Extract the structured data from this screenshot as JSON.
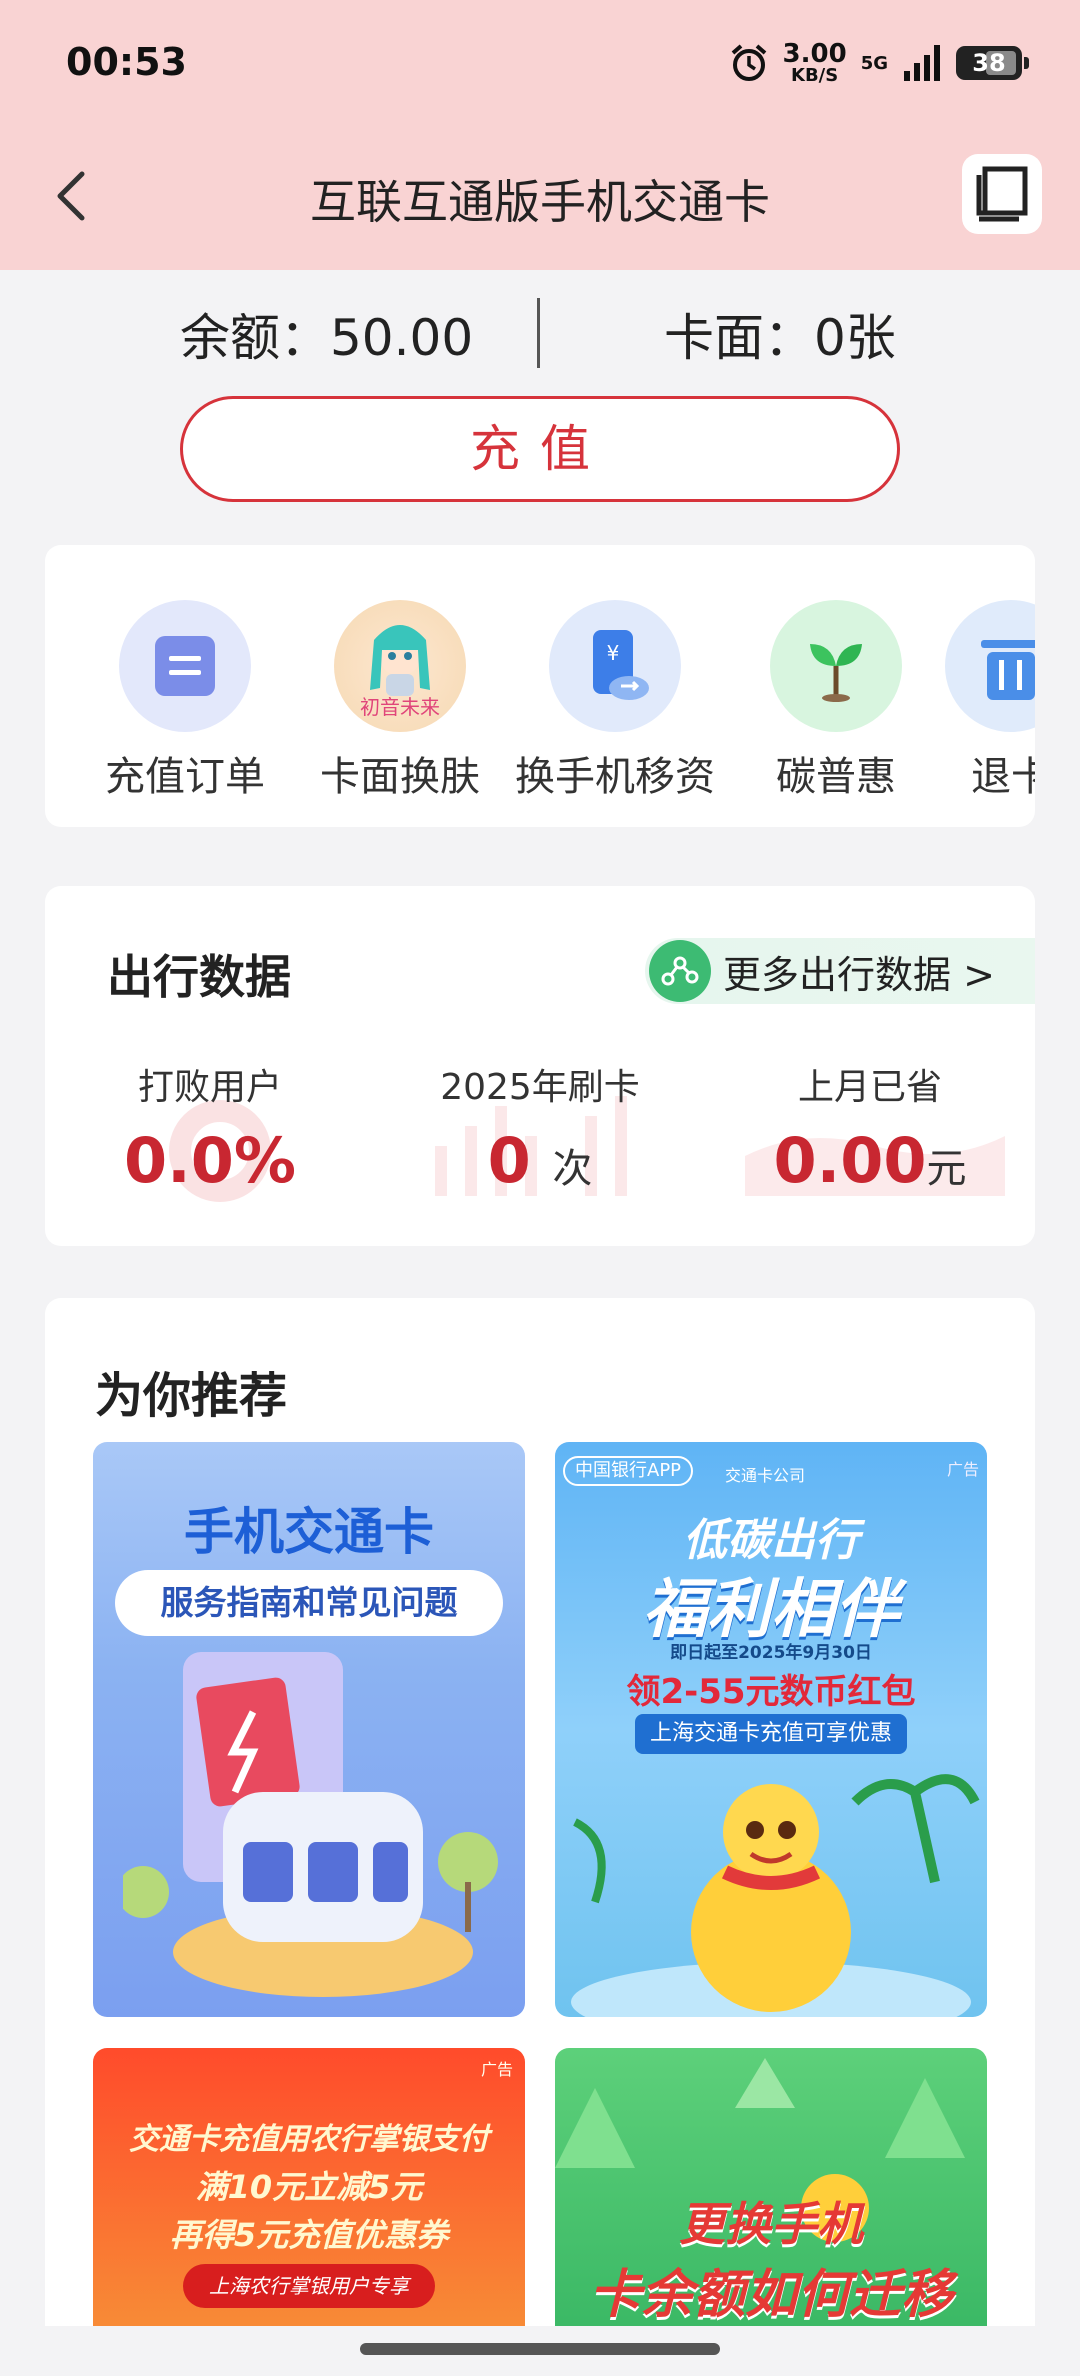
{
  "status_bar": {
    "time": "00:53",
    "net_speed_value": "3.00",
    "net_speed_unit": "KB/S",
    "network": "5G",
    "battery": "38"
  },
  "nav": {
    "title": "互联互通版手机交通卡"
  },
  "balance": {
    "balance_text": "余额：50.00",
    "card_face_text": "卡面：0张"
  },
  "recharge_label": "充值",
  "services": [
    {
      "label": "充值订单",
      "icon": "order-icon"
    },
    {
      "label": "卡面换肤",
      "icon": "skin-icon"
    },
    {
      "label": "换手机移资",
      "icon": "transfer-icon"
    },
    {
      "label": "碳普惠",
      "icon": "sprout-icon"
    },
    {
      "label": "退卡",
      "icon": "trash-icon"
    }
  ],
  "skin_icon_text": "初音未来",
  "travel": {
    "title": "出行数据",
    "more_label": "更多出行数据 >",
    "stats": [
      {
        "key": "打败用户",
        "value": "0.0%",
        "unit": ""
      },
      {
        "key": "2025年刷卡",
        "value": "0",
        "unit": "次"
      },
      {
        "key": "上月已省",
        "value": "0.00",
        "unit": "元"
      }
    ]
  },
  "recommend": {
    "title": "为你推荐",
    "banners": [
      {
        "line1": "手机交通卡",
        "line2": "服务指南和常见问题"
      },
      {
        "tag1": "中国银行APP",
        "tag2": "交通卡公司",
        "ad": "广告",
        "line1": "低碳出行",
        "line2": "福利相伴",
        "line3": "即日起至2025年9月30日",
        "line4": "领2-55元数币红包",
        "line5": "上海交通卡充值可享优惠"
      },
      {
        "ad": "广告",
        "line1": "交通卡充值用农行掌银支付",
        "line2": "满10元立减5元",
        "line3": "再得5元充值优惠券",
        "line4": "上海农行掌银用户专享"
      },
      {
        "line1": "更换手机",
        "line2": "卡余额如何迁移"
      }
    ]
  },
  "colors": {
    "accent": "#d6333b",
    "header_bg": "#f9d3d3",
    "value_red": "#c82731",
    "green": "#3dbb73"
  }
}
